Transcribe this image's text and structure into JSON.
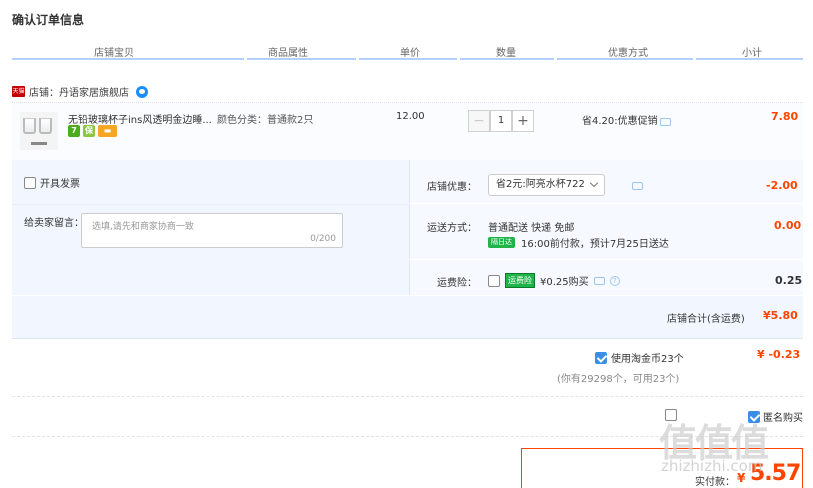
{
  "page_title": "确认订单信息",
  "columns": [
    "店铺宝贝",
    "商品属性",
    "单价",
    "数量",
    "优惠方式",
    "小计"
  ],
  "shop": {
    "badge": "天猫",
    "label": "店铺：丹语家居旗舰店"
  },
  "item": {
    "name": "无铅玻璃杯子ins风透明金边睡...",
    "attr": "颜色分类：普通款2只",
    "unit_price": "12.00",
    "quantity": "1",
    "minus": "−",
    "plus": "+",
    "discount": "省4.20:优惠促销",
    "subtotal": "7.80",
    "icons": [
      {
        "name": "seven-day-return-icon",
        "text": "7",
        "color": "#4dac1b"
      },
      {
        "name": "guarantee-icon",
        "text": "保",
        "color": "#8cc63f"
      },
      {
        "name": "card-pay-icon",
        "text": "▬",
        "color": "#f5a623"
      }
    ]
  },
  "invoice": {
    "label": "开具发票"
  },
  "message": {
    "label": "给卖家留言：",
    "placeholder": "选填,请先和商家协商一致",
    "counter": "0/200"
  },
  "shop_discount": {
    "label": "店铺优惠：",
    "selected": "省2元:阿亮水杯722",
    "amount": "-2.00"
  },
  "shipping": {
    "label": "运送方式：",
    "method": "普通配送 快递 免邮",
    "badge": "隔日达",
    "eta": "16:00前付款，预计7月25日送达",
    "fee": "0.00"
  },
  "insurance": {
    "label": "运费险：",
    "badge": "运费险",
    "price": "¥0.25购买",
    "amount": "0.25"
  },
  "shop_total": {
    "label": "店铺合计(含运费)",
    "amount": "¥5.80"
  },
  "coins": {
    "label": "使用淘金币23个",
    "note": "(你有29298个，可用23个)",
    "amount": "¥ -0.23"
  },
  "footer": {
    "anon_label": "匿名购买",
    "pay_label": "实付款：",
    "currency": "¥",
    "total": "5.57"
  },
  "watermark": {
    "logo": "值值值",
    "url": "zhizhizhi.com"
  },
  "colors": {
    "accent": "#f40",
    "blue": "#3a8ee6",
    "header_line": "#b2d1ff"
  }
}
